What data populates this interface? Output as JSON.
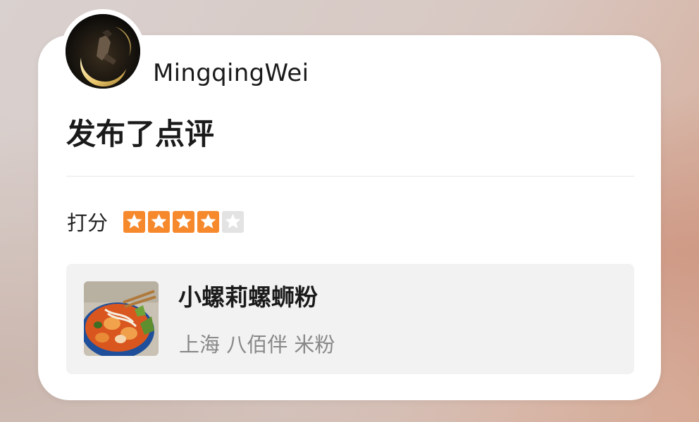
{
  "post": {
    "username": "MingqingWei",
    "action_title": "发布了点评"
  },
  "rating": {
    "label": "打分",
    "score": 4,
    "max": 5,
    "filled_color": "#f7892d",
    "empty_color": "#e3e3e3"
  },
  "shop": {
    "name": "小螺莉螺蛳粉",
    "meta": "上海 八佰伴 米粉",
    "thumbnail_icon": "rice-noodle-bowl-photo"
  },
  "avatar": {
    "icon": "crescent-moon-figure-avatar"
  }
}
